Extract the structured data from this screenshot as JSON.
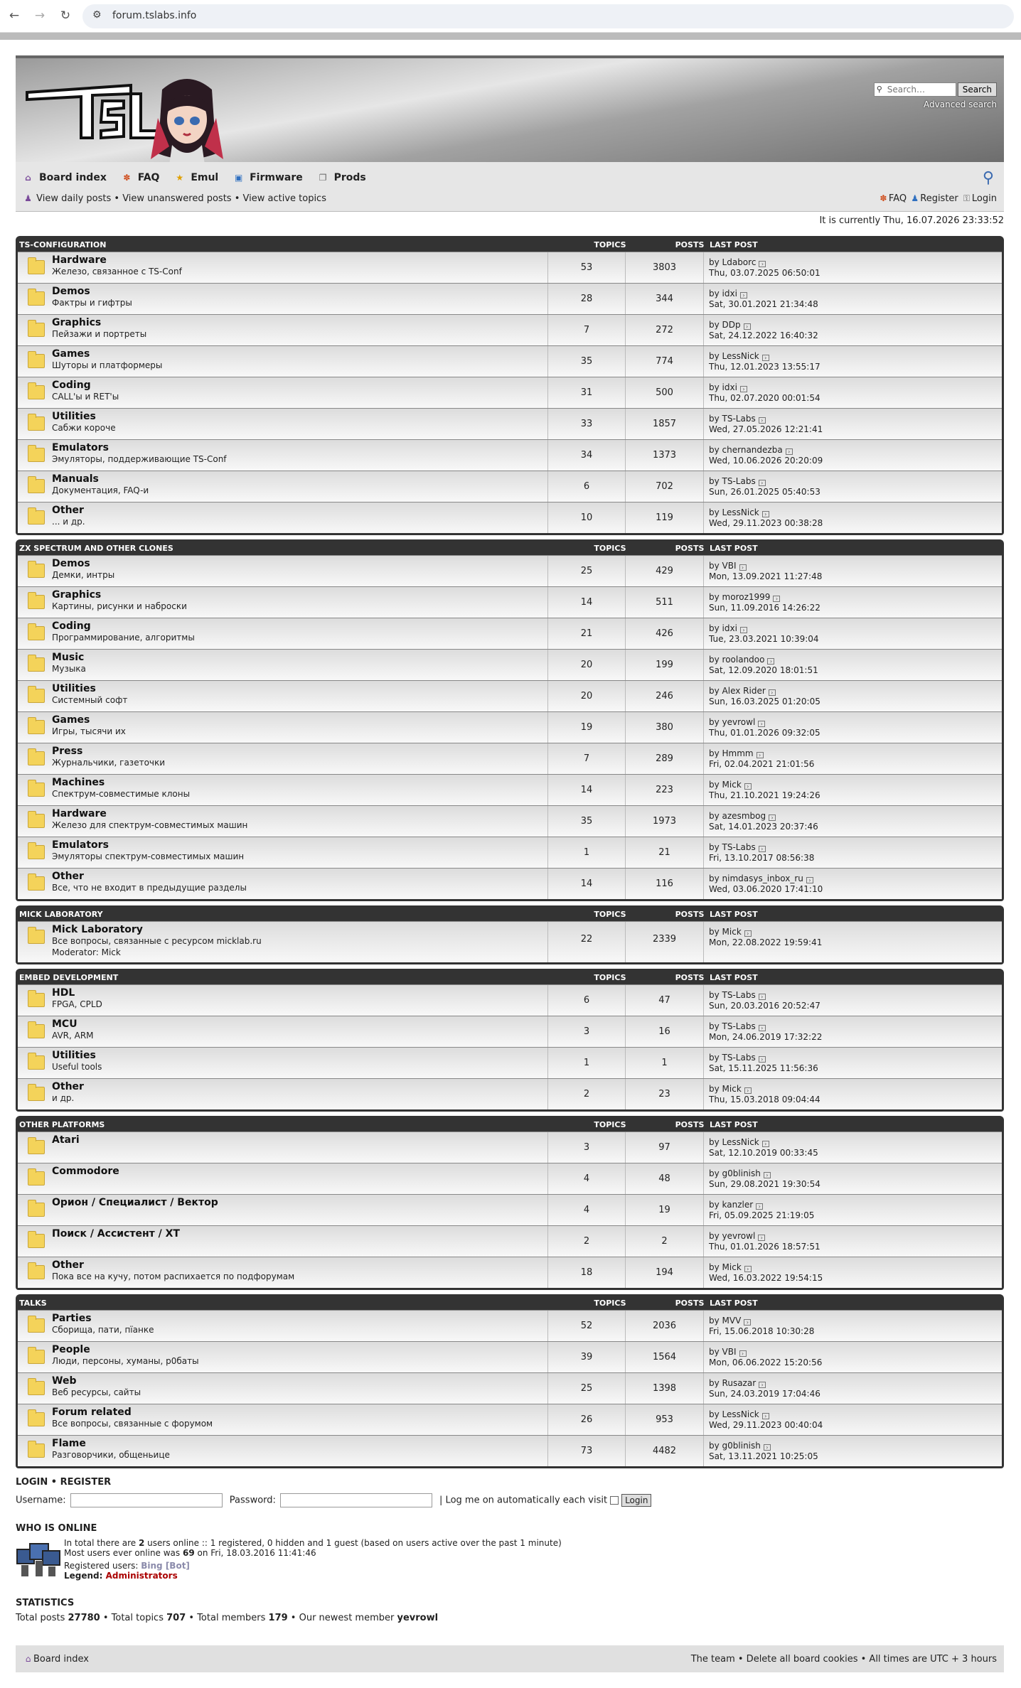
{
  "browser": {
    "url": "forum.tslabs.info"
  },
  "header": {
    "logo_text": "TSL",
    "search_placeholder": "Search…",
    "search_button": "Search",
    "advanced_search": "Advanced search"
  },
  "nav": {
    "board_index": "Board index",
    "faq": "FAQ",
    "emul": "Emul",
    "firmware": "Firmware",
    "prods": "Prods",
    "view_daily": "View daily posts",
    "view_unanswered": "View unanswered posts",
    "view_active": "View active topics",
    "right_faq": "FAQ",
    "register": "Register",
    "login": "Login",
    "sep": "•"
  },
  "current_time": "It is currently Thu, 16.07.2026 23:33:52",
  "col_topics": "TOPICS",
  "col_posts": "POSTS",
  "col_last": "LAST POST",
  "categories": [
    {
      "name": "TS-Configuration",
      "forums": [
        {
          "title": "Hardware",
          "desc": "Железо, связанное с TS-Conf",
          "topics": "53",
          "posts": "3803",
          "by": "by Ldaborc",
          "date": "Thu, 03.07.2025 06:50:01"
        },
        {
          "title": "Demos",
          "desc": "Фактры и гифтры",
          "topics": "28",
          "posts": "344",
          "by": "by idxi",
          "date": "Sat, 30.01.2021 21:34:48"
        },
        {
          "title": "Graphics",
          "desc": "Пейзажи и портреты",
          "topics": "7",
          "posts": "272",
          "by": "by DDp",
          "date": "Sat, 24.12.2022 16:40:32"
        },
        {
          "title": "Games",
          "desc": "Шуторы и платформеры",
          "topics": "35",
          "posts": "774",
          "by": "by LessNick",
          "date": "Thu, 12.01.2023 13:55:17"
        },
        {
          "title": "Coding",
          "desc": "CALL'ы и RET'ы",
          "topics": "31",
          "posts": "500",
          "by": "by idxi",
          "date": "Thu, 02.07.2020 00:01:54"
        },
        {
          "title": "Utilities",
          "desc": "Сабжи короче",
          "topics": "33",
          "posts": "1857",
          "by": "by TS-Labs",
          "date": "Wed, 27.05.2026 12:21:41"
        },
        {
          "title": "Emulators",
          "desc": "Эмуляторы, поддерживающие TS-Conf",
          "topics": "34",
          "posts": "1373",
          "by": "by chernandezba",
          "date": "Wed, 10.06.2026 20:20:09"
        },
        {
          "title": "Manuals",
          "desc": "Документация, FAQ-и",
          "topics": "6",
          "posts": "702",
          "by": "by TS-Labs",
          "date": "Sun, 26.01.2025 05:40:53"
        },
        {
          "title": "Other",
          "desc": "... и др.",
          "topics": "10",
          "posts": "119",
          "by": "by LessNick",
          "date": "Wed, 29.11.2023 00:38:28"
        }
      ]
    },
    {
      "name": "ZX Spectrum and other clones",
      "forums": [
        {
          "title": "Demos",
          "desc": "Демки, интры",
          "topics": "25",
          "posts": "429",
          "by": "by VBI",
          "date": "Mon, 13.09.2021 11:27:48"
        },
        {
          "title": "Graphics",
          "desc": "Картины, рисунки и наброски",
          "topics": "14",
          "posts": "511",
          "by": "by moroz1999",
          "date": "Sun, 11.09.2016 14:26:22"
        },
        {
          "title": "Coding",
          "desc": "Программирование, алгоритмы",
          "topics": "21",
          "posts": "426",
          "by": "by idxi",
          "date": "Tue, 23.03.2021 10:39:04"
        },
        {
          "title": "Music",
          "desc": "Музыка",
          "topics": "20",
          "posts": "199",
          "by": "by roolandoo",
          "date": "Sat, 12.09.2020 18:01:51"
        },
        {
          "title": "Utilities",
          "desc": "Системный софт",
          "topics": "20",
          "posts": "246",
          "by": "by Alex Rider",
          "date": "Sun, 16.03.2025 01:20:05"
        },
        {
          "title": "Games",
          "desc": "Игры, тысячи их",
          "topics": "19",
          "posts": "380",
          "by": "by yevrowl",
          "date": "Thu, 01.01.2026 09:32:05"
        },
        {
          "title": "Press",
          "desc": "Журнальчики, газеточки",
          "topics": "7",
          "posts": "289",
          "by": "by Hmmm",
          "date": "Fri, 02.04.2021 21:01:56"
        },
        {
          "title": "Machines",
          "desc": "Спектрум-совместимые клоны",
          "topics": "14",
          "posts": "223",
          "by": "by Mick",
          "date": "Thu, 21.10.2021 19:24:26"
        },
        {
          "title": "Hardware",
          "desc": "Железо для спектрум-совместимых машин",
          "topics": "35",
          "posts": "1973",
          "by": "by azesmbog",
          "date": "Sat, 14.01.2023 20:37:46"
        },
        {
          "title": "Emulators",
          "desc": "Эмуляторы спектрум-совместимых машин",
          "topics": "1",
          "posts": "21",
          "by": "by TS-Labs",
          "date": "Fri, 13.10.2017 08:56:38"
        },
        {
          "title": "Other",
          "desc": "Все, что не входит в предыдущие разделы",
          "topics": "14",
          "posts": "116",
          "by": "by nimdasys_inbox_ru",
          "date": "Wed, 03.06.2020 17:41:10"
        }
      ]
    },
    {
      "name": "Mick Laboratory",
      "forums": [
        {
          "title": "Mick Laboratory",
          "desc": "Все вопросы, связанные с ресурсом micklab.ru",
          "mod": "Moderator: Mick",
          "topics": "22",
          "posts": "2339",
          "by": "by Mick",
          "date": "Mon, 22.08.2022 19:59:41"
        }
      ]
    },
    {
      "name": "Embed development",
      "forums": [
        {
          "title": "HDL",
          "desc": "FPGA, CPLD",
          "topics": "6",
          "posts": "47",
          "by": "by TS-Labs",
          "date": "Sun, 20.03.2016 20:52:47"
        },
        {
          "title": "MCU",
          "desc": "AVR, ARM",
          "topics": "3",
          "posts": "16",
          "by": "by TS-Labs",
          "date": "Mon, 24.06.2019 17:32:22"
        },
        {
          "title": "Utilities",
          "desc": "Useful tools",
          "topics": "1",
          "posts": "1",
          "by": "by TS-Labs",
          "date": "Sat, 15.11.2025 11:56:36"
        },
        {
          "title": "Other",
          "desc": "и др.",
          "topics": "2",
          "posts": "23",
          "by": "by Mick",
          "date": "Thu, 15.03.2018 09:04:44"
        }
      ]
    },
    {
      "name": "Other platforms",
      "forums": [
        {
          "title": "Atari",
          "desc": "",
          "topics": "3",
          "posts": "97",
          "by": "by LessNick",
          "date": "Sat, 12.10.2019 00:33:45"
        },
        {
          "title": "Commodore",
          "desc": "",
          "topics": "4",
          "posts": "48",
          "by": "by g0blinish",
          "date": "Sun, 29.08.2021 19:30:54"
        },
        {
          "title": "Орион / Специалист / Вектор",
          "desc": "",
          "topics": "4",
          "posts": "19",
          "by": "by kanzler",
          "date": "Fri, 05.09.2025 21:19:05"
        },
        {
          "title": "Поиск / Ассистент / XT",
          "desc": "",
          "topics": "2",
          "posts": "2",
          "by": "by yevrowl",
          "date": "Thu, 01.01.2026 18:57:51"
        },
        {
          "title": "Other",
          "desc": "Пока все на кучу, потом распихается по подфорумам",
          "topics": "18",
          "posts": "194",
          "by": "by Mick",
          "date": "Wed, 16.03.2022 19:54:15"
        }
      ]
    },
    {
      "name": "Talks",
      "forums": [
        {
          "title": "Parties",
          "desc": "Сборища, пати, пїанке",
          "topics": "52",
          "posts": "2036",
          "by": "by MVV",
          "date": "Fri, 15.06.2018 10:30:28"
        },
        {
          "title": "People",
          "desc": "Люди, персоны, хуманы, р0баты",
          "topics": "39",
          "posts": "1564",
          "by": "by VBI",
          "date": "Mon, 06.06.2022 15:20:56"
        },
        {
          "title": "Web",
          "desc": "Веб ресурсы, сайты",
          "topics": "25",
          "posts": "1398",
          "by": "by Rusazar",
          "date": "Sun, 24.03.2019 17:04:46"
        },
        {
          "title": "Forum related",
          "desc": "Все вопросы, связанные с форумом",
          "topics": "26",
          "posts": "953",
          "by": "by LessNick",
          "date": "Wed, 29.11.2023 00:40:04"
        },
        {
          "title": "Flame",
          "desc": "Разговорчики, общеньице",
          "topics": "73",
          "posts": "4482",
          "by": "by g0blinish",
          "date": "Sat, 13.11.2021 10:25:05"
        }
      ]
    }
  ],
  "login_box": {
    "title": "LOGIN • REGISTER",
    "username": "Username:",
    "password": "Password:",
    "remember": "| Log me on automatically each visit",
    "button": "Login"
  },
  "who_online": {
    "title": "WHO IS ONLINE",
    "line1_a": "In total there are ",
    "line1_b": "2",
    "line1_c": " users online :: 1 registered, 0 hidden and 1 guest (based on users active over the past 1 minute)",
    "line2_a": "Most users ever online was ",
    "line2_b": "69",
    "line2_c": " on Fri, 18.03.2016 11:41:46",
    "registered_label": "Registered users: ",
    "registered_value": "Bing [Bot]",
    "legend_label": "Legend: ",
    "legend_value": "Administrators"
  },
  "statistics": {
    "title": "STATISTICS",
    "a": "Total posts ",
    "b": "27780",
    "c": " • Total topics ",
    "d": "707",
    "e": " • Total members ",
    "f": "179",
    "g": " • Our newest member ",
    "h": "yevrowl"
  },
  "footer": {
    "board_index": "Board index",
    "right": "The team • Delete all board cookies • All times are UTC + 3 hours"
  }
}
